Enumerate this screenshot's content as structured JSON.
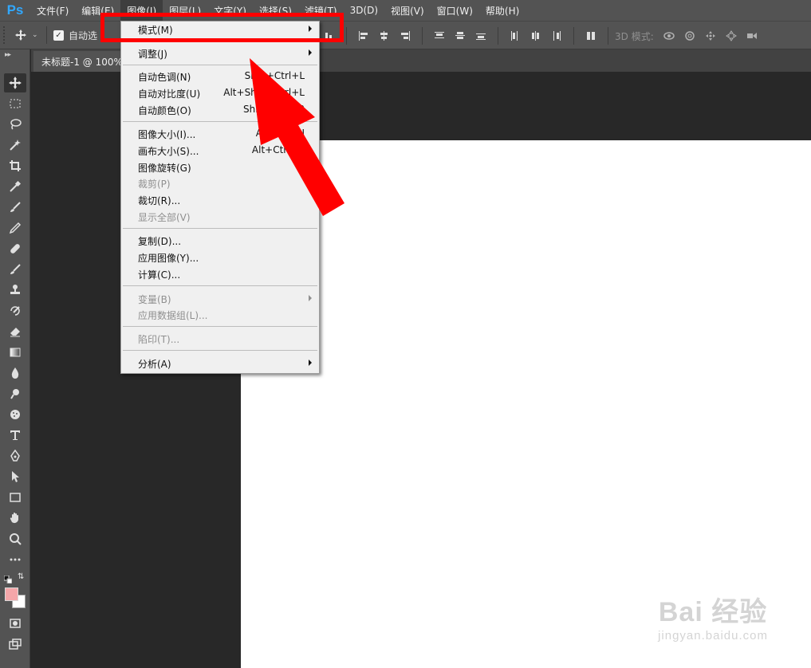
{
  "app": {
    "logo": "Ps"
  },
  "menubar": {
    "items": [
      "文件(F)",
      "编辑(E)",
      "图像(I)",
      "图层(L)",
      "文字(Y)",
      "选择(S)",
      "滤镜(T)",
      "3D(D)",
      "视图(V)",
      "窗口(W)",
      "帮助(H)"
    ],
    "active_index": 2
  },
  "options": {
    "auto_select_label": "自动选",
    "auto_select_checked": true,
    "mode3d_label": "3D 模式:"
  },
  "document": {
    "tab_label": "未标题-1 @ 100%"
  },
  "colors": {
    "foreground": "#f4a6a9",
    "background": "#ffffff",
    "highlight": "#ff0000"
  },
  "image_menu": {
    "mode": "模式(M)",
    "adjust": "调整(J)",
    "auto_tone": {
      "label": "自动色调(N)",
      "shortcut": "Shift+Ctrl+L"
    },
    "auto_contrast": {
      "label": "自动对比度(U)",
      "shortcut": "Alt+Shift+Ctrl+L"
    },
    "auto_color": {
      "label": "自动颜色(O)",
      "shortcut": "Shift+Ctrl+B"
    },
    "image_size": {
      "label": "图像大小(I)...",
      "shortcut": "Alt+Ctrl+I"
    },
    "canvas_size": {
      "label": "画布大小(S)...",
      "shortcut": "Alt+Ctrl+C"
    },
    "rotation": "图像旋转(G)",
    "crop": "裁剪(P)",
    "trim": "裁切(R)...",
    "reveal_all": "显示全部(V)",
    "duplicate": "复制(D)...",
    "apply_image": "应用图像(Y)...",
    "calculations": "计算(C)...",
    "variables": "变量(B)",
    "apply_data_set": "应用数据组(L)...",
    "trap": "陷印(T)...",
    "analysis": "分析(A)"
  },
  "watermark": {
    "main": "Bai 经验",
    "sub": "jingyan.baidu.com"
  }
}
